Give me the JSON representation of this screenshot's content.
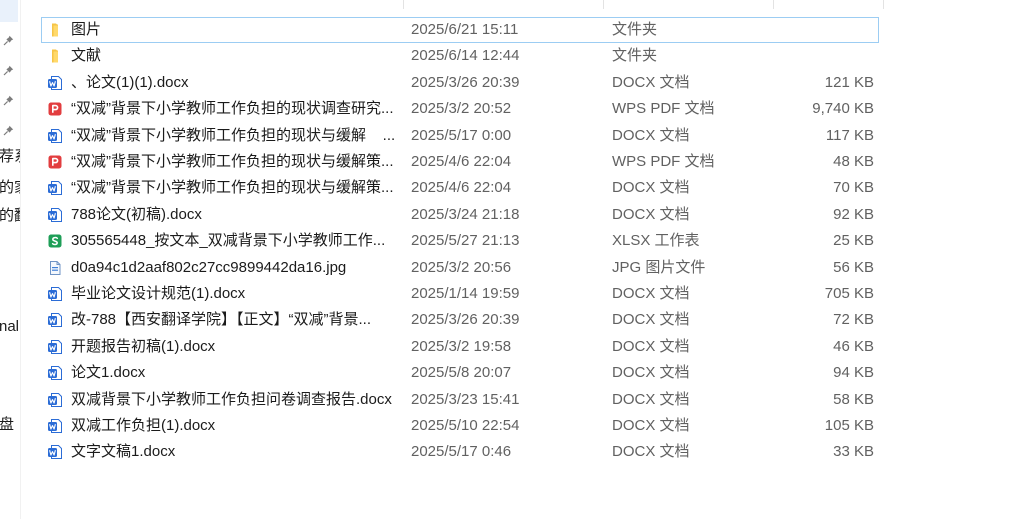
{
  "colors": {
    "name_text": "#1b1b1b",
    "detail_text": "#616161",
    "focus_border": "#9ccdf3",
    "sidebar_selected": "#e9f1fb",
    "pin": "#7d7d7d",
    "folder": "#f6c445",
    "folder_light": "#ffd96b",
    "word": "#2b6cd6",
    "pdf": "#e23d3f",
    "xlsx": "#1e9e57",
    "image_file": "#6f93c4"
  },
  "sidebar": {
    "pinned": [
      {
        "icon": "pin-icon"
      },
      {
        "icon": "pin-icon"
      },
      {
        "icon": "pin-icon"
      },
      {
        "icon": "pin-icon"
      }
    ],
    "labels": [
      "荐系",
      "的家",
      "的翻",
      "nal",
      "盘"
    ]
  },
  "file_list": {
    "rows": [
      {
        "icon": "folder-icon",
        "name": "图片",
        "date": "2025/6/21 15:11",
        "type": "文件夹",
        "size": "",
        "focused": true
      },
      {
        "icon": "folder-icon",
        "name": "文献",
        "date": "2025/6/14 12:44",
        "type": "文件夹",
        "size": ""
      },
      {
        "icon": "word-doc-icon",
        "name": "、论文(1)(1).docx",
        "date": "2025/3/26 20:39",
        "type": "DOCX 文档",
        "size": "121 KB"
      },
      {
        "icon": "pdf-doc-icon",
        "name": "“双减”背景下小学教师工作负担的现状调查研究...",
        "date": "2025/3/2 20:52",
        "type": "WPS PDF 文档",
        "size": "9,740 KB"
      },
      {
        "icon": "word-doc-icon",
        "name": "“双减”背景下小学教师工作负担的现状与缓解    ...",
        "date": "2025/5/17 0:00",
        "type": "DOCX 文档",
        "size": "117 KB"
      },
      {
        "icon": "pdf-doc-icon",
        "name": "“双减”背景下小学教师工作负担的现状与缓解策...",
        "date": "2025/4/6 22:04",
        "type": "WPS PDF 文档",
        "size": "48 KB"
      },
      {
        "icon": "word-doc-icon",
        "name": "“双减”背景下小学教师工作负担的现状与缓解策...",
        "date": "2025/4/6 22:04",
        "type": "DOCX 文档",
        "size": "70 KB"
      },
      {
        "icon": "word-doc-icon",
        "name": "788论文(初稿).docx",
        "date": "2025/3/24 21:18",
        "type": "DOCX 文档",
        "size": "92 KB"
      },
      {
        "icon": "spreadsheet-icon",
        "name": "305565448_按文本_双减背景下小学教师工作...",
        "date": "2025/5/27 21:13",
        "type": "XLSX 工作表",
        "size": "25 KB"
      },
      {
        "icon": "image-file-icon",
        "name": "d0a94c1d2aaf802c27cc9899442da16.jpg",
        "date": "2025/3/2 20:56",
        "type": "JPG 图片文件",
        "size": "56 KB"
      },
      {
        "icon": "word-doc-icon",
        "name": "毕业论文设计规范(1).docx",
        "date": "2025/1/14 19:59",
        "type": "DOCX 文档",
        "size": "705 KB"
      },
      {
        "icon": "word-doc-icon",
        "name": "改-788【西安翻译学院】【正文】“双减”背景...",
        "date": "2025/3/26 20:39",
        "type": "DOCX 文档",
        "size": "72 KB"
      },
      {
        "icon": "word-doc-icon",
        "name": "开题报告初稿(1).docx",
        "date": "2025/3/2 19:58",
        "type": "DOCX 文档",
        "size": "46 KB"
      },
      {
        "icon": "word-doc-icon",
        "name": "论文1.docx",
        "date": "2025/5/8 20:07",
        "type": "DOCX 文档",
        "size": "94 KB"
      },
      {
        "icon": "word-doc-icon",
        "name": "双减背景下小学教师工作负担问卷调查报告.docx",
        "date": "2025/3/23 15:41",
        "type": "DOCX 文档",
        "size": "58 KB"
      },
      {
        "icon": "word-doc-icon",
        "name": "双减工作负担(1).docx",
        "date": "2025/5/10 22:54",
        "type": "DOCX 文档",
        "size": "105 KB"
      },
      {
        "icon": "word-doc-icon",
        "name": "文字文稿1.docx",
        "date": "2025/5/17 0:46",
        "type": "DOCX 文档",
        "size": "33 KB"
      }
    ]
  }
}
